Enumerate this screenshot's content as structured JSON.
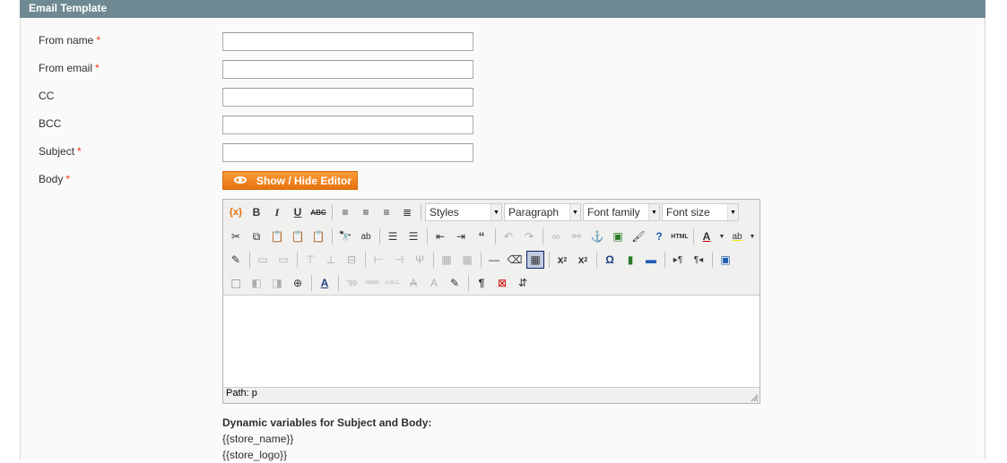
{
  "header": {
    "title": "Email Template"
  },
  "form": {
    "from_name": {
      "label": "From name",
      "required": "*",
      "value": ""
    },
    "from_email": {
      "label": "From email",
      "required": "*",
      "value": ""
    },
    "cc": {
      "label": "CC",
      "value": ""
    },
    "bcc": {
      "label": "BCC",
      "value": ""
    },
    "subject": {
      "label": "Subject",
      "required": "*",
      "value": ""
    },
    "body": {
      "label": "Body",
      "required": "*"
    }
  },
  "editor": {
    "toggle_label": "Show / Hide Editor",
    "styles": "Styles",
    "format": "Paragraph",
    "font_family": "Font family",
    "font_size": "Font size",
    "path": "Path: p",
    "content": ""
  },
  "variables": {
    "heading": "Dynamic variables for Subject and Body:",
    "items": [
      "{{store_name}}",
      "{{store_logo}}"
    ]
  },
  "colors": {
    "header_bg": "#6f8992",
    "accent": "#f08a24",
    "required": "#eb340a"
  }
}
